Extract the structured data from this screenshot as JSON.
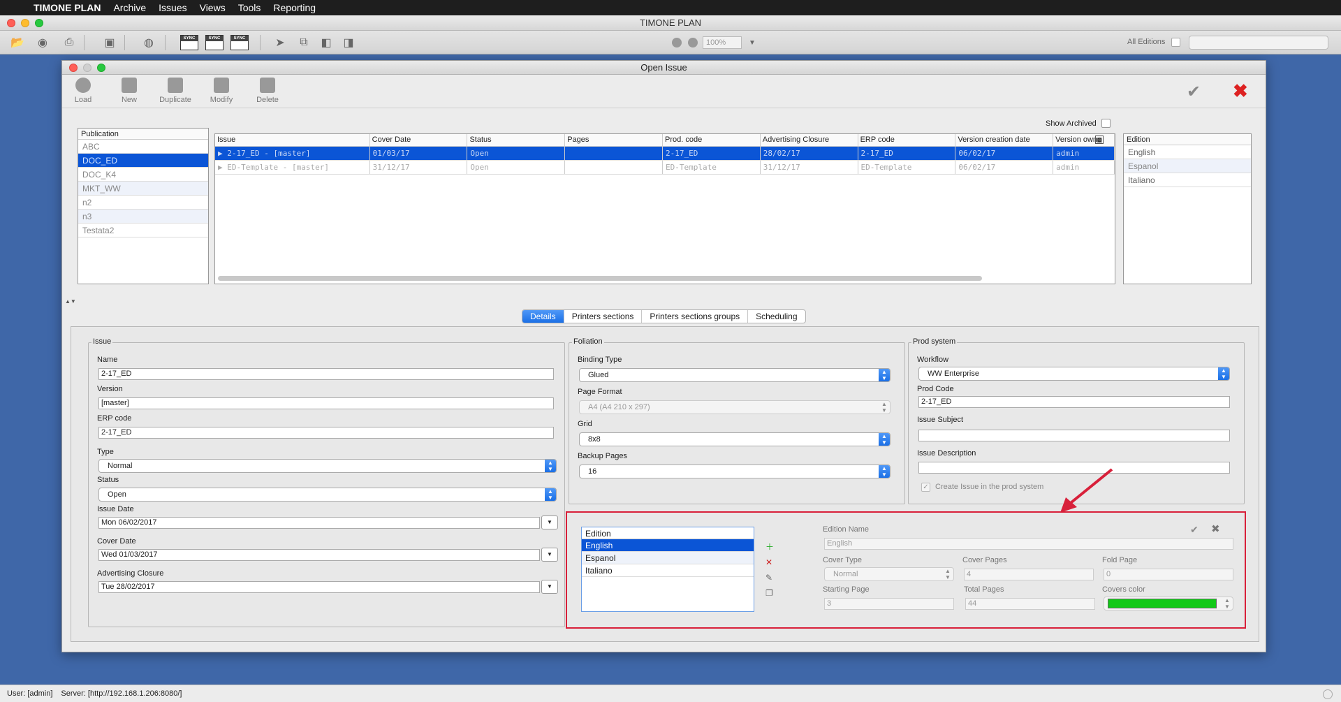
{
  "menubar": {
    "app": "TIMONE PLAN",
    "items": [
      "Archive",
      "Issues",
      "Views",
      "Tools",
      "Reporting"
    ]
  },
  "window": {
    "title": "TIMONE PLAN"
  },
  "toolbar": {
    "zoom": "100%",
    "all_editions_label": "All Editions"
  },
  "dialog": {
    "title": "Open Issue",
    "actions": {
      "load": "Load",
      "new": "New",
      "duplicate": "Duplicate",
      "modify": "Modify",
      "delete": "Delete"
    },
    "show_archived": "Show Archived",
    "publication": {
      "header": "Publication",
      "items": [
        {
          "label": "ABC"
        },
        {
          "label": "DOC_ED"
        },
        {
          "label": "DOC_K4"
        },
        {
          "label": "MKT_WW"
        },
        {
          "label": "n2"
        },
        {
          "label": "n3"
        },
        {
          "label": "Testata2"
        }
      ]
    },
    "issues": {
      "columns": [
        "Issue",
        "Cover Date",
        "Status",
        "Pages",
        "Prod. code",
        "Advertising Closure",
        "ERP code",
        "Version creation date",
        "Version owne"
      ],
      "rows": [
        [
          "2-17_ED - [master]",
          "01/03/17",
          "Open",
          "",
          "2-17_ED",
          "28/02/17",
          "2-17_ED",
          "06/02/17",
          "admin"
        ],
        [
          "ED-Template - [master]",
          "31/12/17",
          "Open",
          "",
          "ED-Template",
          "31/12/17",
          "ED-Template",
          "06/02/17",
          "admin"
        ]
      ]
    },
    "editions_top": {
      "header": "Edition",
      "items": [
        "English",
        "Espanol",
        "Italiano"
      ]
    },
    "tabs": [
      "Details",
      "Printers sections",
      "Printers sections groups",
      "Scheduling"
    ],
    "issue_group": {
      "label": "Issue",
      "name_label": "Name",
      "name": "2-17_ED",
      "version_label": "Version",
      "version": "[master]",
      "erp_label": "ERP code",
      "erp": "2-17_ED",
      "type_label": "Type",
      "type": "Normal",
      "status_label": "Status",
      "status": "Open",
      "issue_date_label": "Issue Date",
      "issue_date": "Mon 06/02/2017",
      "cover_date_label": "Cover Date",
      "cover_date": "Wed 01/03/2017",
      "adv_label": "Advertising Closure",
      "adv": "Tue 28/02/2017"
    },
    "foliation": {
      "label": "Foliation",
      "binding_label": "Binding Type",
      "binding": "Glued",
      "format_label": "Page Format",
      "format": "A4 (A4 210 x 297)",
      "grid_label": "Grid",
      "grid": "8x8",
      "backup_label": "Backup Pages",
      "backup": "16"
    },
    "prod": {
      "label": "Prod system",
      "workflow_label": "Workflow",
      "workflow": "WW Enterprise",
      "prodcode_label": "Prod Code",
      "prodcode": "2-17_ED",
      "subject_label": "Issue Subject",
      "subject": "",
      "desc_label": "Issue Description",
      "desc": "",
      "create_label": "Create Issue in the prod system"
    },
    "edition_panel": {
      "list_header": "Edition",
      "items": [
        "English",
        "Espanol",
        "Italiano"
      ],
      "name_label": "Edition Name",
      "name": "English",
      "cover_type_label": "Cover Type",
      "cover_type": "Normal",
      "cover_pages_label": "Cover Pages",
      "cover_pages": "4",
      "fold_page_label": "Fold Page",
      "fold_page": "0",
      "starting_page_label": "Starting Page",
      "starting_page": "3",
      "total_pages_label": "Total Pages",
      "total_pages": "44",
      "covers_color_label": "Covers color",
      "covers_color": "#12c918"
    }
  },
  "status": {
    "user": "User: [admin]",
    "server": "Server: [http://192.168.1.206:8080/]"
  }
}
